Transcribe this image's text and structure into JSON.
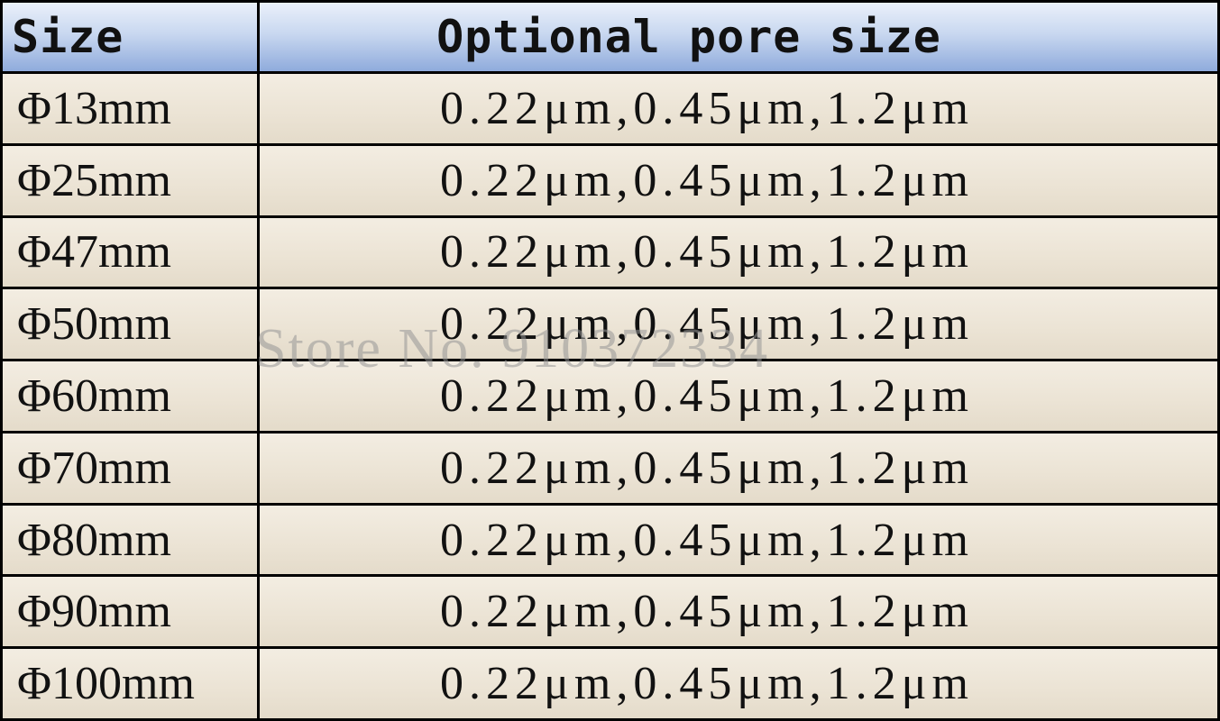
{
  "table": {
    "headers": {
      "size": "Size",
      "pore": "Optional pore size"
    },
    "rows": [
      {
        "size": "Φ13mm",
        "pore": "0.22μm,0.45μm,1.2μm"
      },
      {
        "size": "Φ25mm",
        "pore": "0.22μm,0.45μm,1.2μm"
      },
      {
        "size": "Φ47mm",
        "pore": "0.22μm,0.45μm,1.2μm"
      },
      {
        "size": "Φ50mm",
        "pore": "0.22μm,0.45μm,1.2μm"
      },
      {
        "size": "Φ60mm",
        "pore": "0.22μm,0.45μm,1.2μm"
      },
      {
        "size": "Φ70mm",
        "pore": "0.22μm,0.45μm,1.2μm"
      },
      {
        "size": "Φ80mm",
        "pore": "0.22μm,0.45μm,1.2μm"
      },
      {
        "size": "Φ90mm",
        "pore": "0.22μm,0.45μm,1.2μm"
      },
      {
        "size": "Φ100mm",
        "pore": "0.22μm,0.45μm,1.2μm"
      }
    ]
  },
  "watermark": "Store No. 910372334",
  "colors": {
    "header_blue": "#8fabdc",
    "cell_beige": "#ebe3d4",
    "border": "#000000"
  }
}
